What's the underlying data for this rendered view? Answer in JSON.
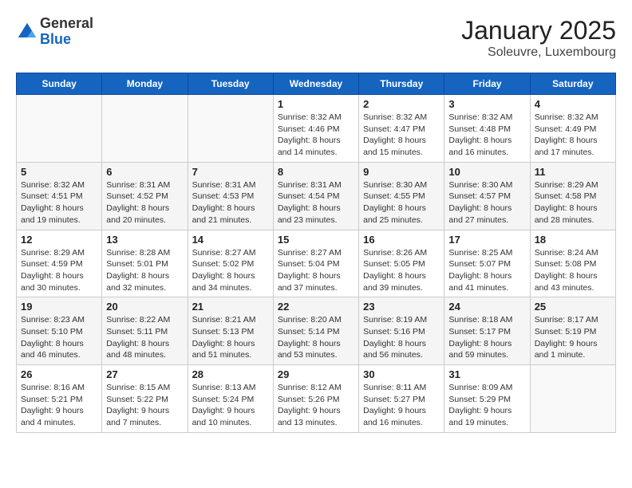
{
  "header": {
    "logo_general": "General",
    "logo_blue": "Blue",
    "month": "January 2025",
    "location": "Soleuvre, Luxembourg"
  },
  "weekdays": [
    "Sunday",
    "Monday",
    "Tuesday",
    "Wednesday",
    "Thursday",
    "Friday",
    "Saturday"
  ],
  "weeks": [
    [
      {
        "day": "",
        "info": ""
      },
      {
        "day": "",
        "info": ""
      },
      {
        "day": "",
        "info": ""
      },
      {
        "day": "1",
        "info": "Sunrise: 8:32 AM\nSunset: 4:46 PM\nDaylight: 8 hours\nand 14 minutes."
      },
      {
        "day": "2",
        "info": "Sunrise: 8:32 AM\nSunset: 4:47 PM\nDaylight: 8 hours\nand 15 minutes."
      },
      {
        "day": "3",
        "info": "Sunrise: 8:32 AM\nSunset: 4:48 PM\nDaylight: 8 hours\nand 16 minutes."
      },
      {
        "day": "4",
        "info": "Sunrise: 8:32 AM\nSunset: 4:49 PM\nDaylight: 8 hours\nand 17 minutes."
      }
    ],
    [
      {
        "day": "5",
        "info": "Sunrise: 8:32 AM\nSunset: 4:51 PM\nDaylight: 8 hours\nand 19 minutes."
      },
      {
        "day": "6",
        "info": "Sunrise: 8:31 AM\nSunset: 4:52 PM\nDaylight: 8 hours\nand 20 minutes."
      },
      {
        "day": "7",
        "info": "Sunrise: 8:31 AM\nSunset: 4:53 PM\nDaylight: 8 hours\nand 21 minutes."
      },
      {
        "day": "8",
        "info": "Sunrise: 8:31 AM\nSunset: 4:54 PM\nDaylight: 8 hours\nand 23 minutes."
      },
      {
        "day": "9",
        "info": "Sunrise: 8:30 AM\nSunset: 4:55 PM\nDaylight: 8 hours\nand 25 minutes."
      },
      {
        "day": "10",
        "info": "Sunrise: 8:30 AM\nSunset: 4:57 PM\nDaylight: 8 hours\nand 27 minutes."
      },
      {
        "day": "11",
        "info": "Sunrise: 8:29 AM\nSunset: 4:58 PM\nDaylight: 8 hours\nand 28 minutes."
      }
    ],
    [
      {
        "day": "12",
        "info": "Sunrise: 8:29 AM\nSunset: 4:59 PM\nDaylight: 8 hours\nand 30 minutes."
      },
      {
        "day": "13",
        "info": "Sunrise: 8:28 AM\nSunset: 5:01 PM\nDaylight: 8 hours\nand 32 minutes."
      },
      {
        "day": "14",
        "info": "Sunrise: 8:27 AM\nSunset: 5:02 PM\nDaylight: 8 hours\nand 34 minutes."
      },
      {
        "day": "15",
        "info": "Sunrise: 8:27 AM\nSunset: 5:04 PM\nDaylight: 8 hours\nand 37 minutes."
      },
      {
        "day": "16",
        "info": "Sunrise: 8:26 AM\nSunset: 5:05 PM\nDaylight: 8 hours\nand 39 minutes."
      },
      {
        "day": "17",
        "info": "Sunrise: 8:25 AM\nSunset: 5:07 PM\nDaylight: 8 hours\nand 41 minutes."
      },
      {
        "day": "18",
        "info": "Sunrise: 8:24 AM\nSunset: 5:08 PM\nDaylight: 8 hours\nand 43 minutes."
      }
    ],
    [
      {
        "day": "19",
        "info": "Sunrise: 8:23 AM\nSunset: 5:10 PM\nDaylight: 8 hours\nand 46 minutes."
      },
      {
        "day": "20",
        "info": "Sunrise: 8:22 AM\nSunset: 5:11 PM\nDaylight: 8 hours\nand 48 minutes."
      },
      {
        "day": "21",
        "info": "Sunrise: 8:21 AM\nSunset: 5:13 PM\nDaylight: 8 hours\nand 51 minutes."
      },
      {
        "day": "22",
        "info": "Sunrise: 8:20 AM\nSunset: 5:14 PM\nDaylight: 8 hours\nand 53 minutes."
      },
      {
        "day": "23",
        "info": "Sunrise: 8:19 AM\nSunset: 5:16 PM\nDaylight: 8 hours\nand 56 minutes."
      },
      {
        "day": "24",
        "info": "Sunrise: 8:18 AM\nSunset: 5:17 PM\nDaylight: 8 hours\nand 59 minutes."
      },
      {
        "day": "25",
        "info": "Sunrise: 8:17 AM\nSunset: 5:19 PM\nDaylight: 9 hours\nand 1 minute."
      }
    ],
    [
      {
        "day": "26",
        "info": "Sunrise: 8:16 AM\nSunset: 5:21 PM\nDaylight: 9 hours\nand 4 minutes."
      },
      {
        "day": "27",
        "info": "Sunrise: 8:15 AM\nSunset: 5:22 PM\nDaylight: 9 hours\nand 7 minutes."
      },
      {
        "day": "28",
        "info": "Sunrise: 8:13 AM\nSunset: 5:24 PM\nDaylight: 9 hours\nand 10 minutes."
      },
      {
        "day": "29",
        "info": "Sunrise: 8:12 AM\nSunset: 5:26 PM\nDaylight: 9 hours\nand 13 minutes."
      },
      {
        "day": "30",
        "info": "Sunrise: 8:11 AM\nSunset: 5:27 PM\nDaylight: 9 hours\nand 16 minutes."
      },
      {
        "day": "31",
        "info": "Sunrise: 8:09 AM\nSunset: 5:29 PM\nDaylight: 9 hours\nand 19 minutes."
      },
      {
        "day": "",
        "info": ""
      }
    ]
  ]
}
